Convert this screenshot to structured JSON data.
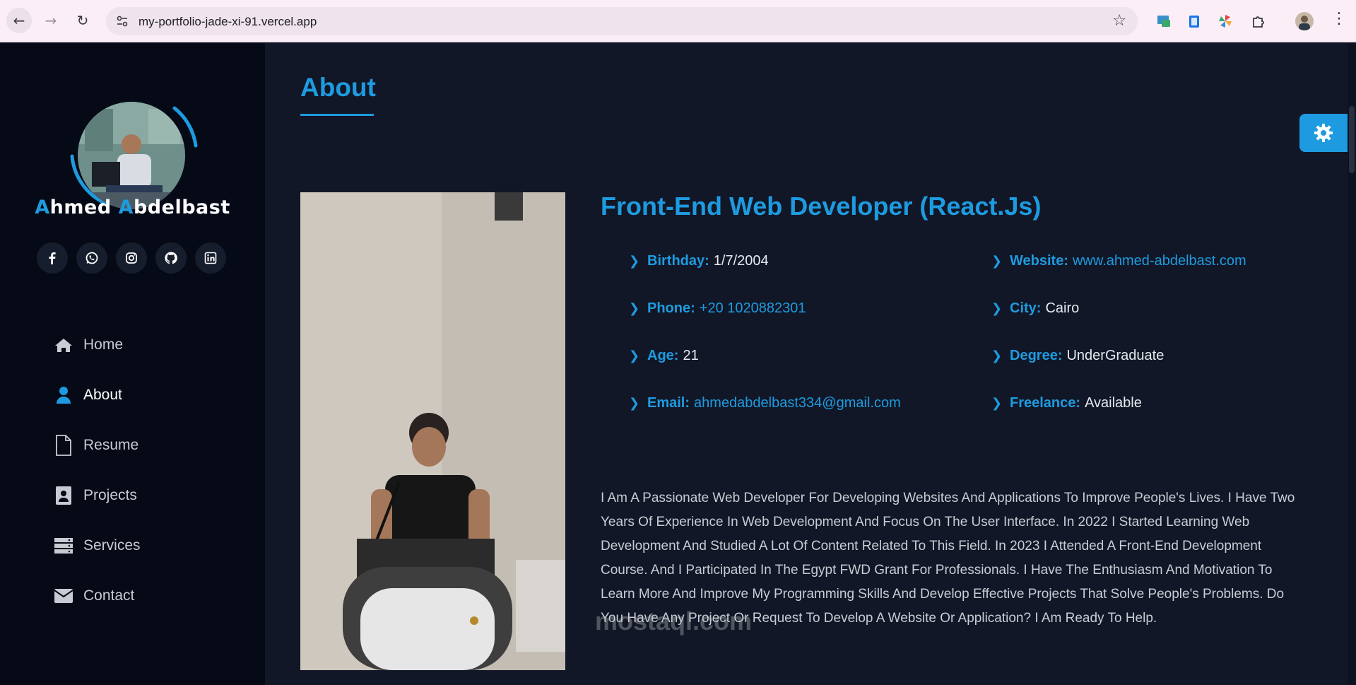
{
  "browser": {
    "url": "my-portfolio-jade-xi-91.vercel.app",
    "extensions": [
      "monitor-extension-icon",
      "clipboard-extension-icon",
      "color-pinwheel-extension-icon",
      "puzzle-extensions-icon"
    ]
  },
  "sidebar": {
    "name_first_initial": "A",
    "name_first_rest": "hmed",
    "name_last_initial": "A",
    "name_last_rest": "bdelbast",
    "socials": [
      "facebook-icon",
      "whatsapp-icon",
      "instagram-icon",
      "github-icon",
      "linkedin-icon"
    ],
    "menu": [
      {
        "label": "Home",
        "icon": "home-icon"
      },
      {
        "label": "About",
        "icon": "user-icon"
      },
      {
        "label": "Resume",
        "icon": "file-icon"
      },
      {
        "label": "Projects",
        "icon": "portfolio-icon"
      },
      {
        "label": "Services",
        "icon": "server-icon"
      },
      {
        "label": "Contact",
        "icon": "envelope-icon"
      }
    ]
  },
  "main": {
    "section_title": "About",
    "role": "Front-End Web Developer (React.Js)",
    "info": [
      {
        "label": "Birthday:",
        "value": "1/7/2004"
      },
      {
        "label": "Website:",
        "value": "www.ahmed-abdelbast.com"
      },
      {
        "label": "Phone:",
        "value": "+20 1020882301"
      },
      {
        "label": "City:",
        "value": "Cairo"
      },
      {
        "label": "Age:",
        "value": "21"
      },
      {
        "label": "Degree:",
        "value": "UnderGraduate"
      },
      {
        "label": "Email:",
        "value": "ahmedabdelbast334@gmail.com"
      },
      {
        "label": "Freelance:",
        "value": "Available"
      }
    ],
    "bio": "I Am A Passionate Web Developer For Developing Websites And Applications To Improve People's Lives. I Have Two Years Of Experience In Web Development And Focus On The User Interface. In 2022 I Started Learning Web Development And Studied A Lot Of Content Related To This Field. In 2023 I Attended A Front-End Development Course. And I Participated In The Egypt FWD Grant For Professionals. I Have The Enthusiasm And Motivation To Learn More And Improve My Programming Skills And Develop Effective Projects That Solve People's Problems. Do You Have Any Project Or Request To Develop A Website Or Application? I Am Ready To Help."
  },
  "watermark": "mostaql.com",
  "colors": {
    "accent": "#1e9be0",
    "sidebar_bg": "#050a16",
    "main_bg": "#111726"
  }
}
